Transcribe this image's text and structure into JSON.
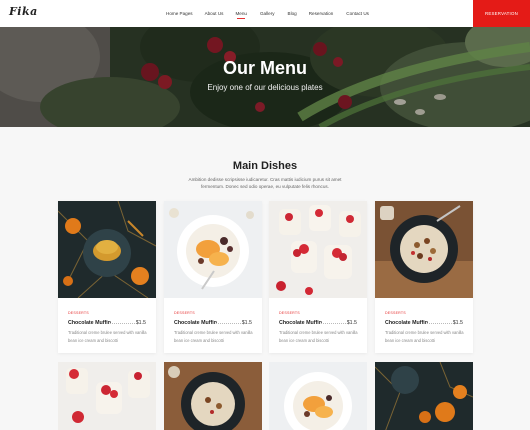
{
  "brand": {
    "logo": "Fika"
  },
  "nav": {
    "items": [
      {
        "label": "Home Pages"
      },
      {
        "label": "About Us"
      },
      {
        "label": "Menu"
      },
      {
        "label": "Gallery"
      },
      {
        "label": "Blog"
      },
      {
        "label": "Reservation"
      },
      {
        "label": "Contact Us"
      }
    ],
    "active_item": "Menu",
    "reservation_button": "RESERVATION"
  },
  "hero": {
    "title": "Our Menu",
    "subtitle": "Enjoy one of our delicious plates"
  },
  "section": {
    "title": "Main Dishes",
    "description": "Ambition dedisse scripsisse iudicaretur. Cras mattis iudicium purus sit amet fermentum. Donec sed odio operae, eu vulputate felis rhoncus."
  },
  "cards": [
    {
      "image": "pancakes-orange",
      "category": "DESSERTS",
      "name": "Chocolate Muffin",
      "price": "$1.5",
      "description": "Traditional creme brulee served with vanilla bean ice cream and biscotti"
    },
    {
      "image": "yogurt-apricot",
      "category": "DESSERTS",
      "name": "Chocolate Muffin",
      "price": "$1.5",
      "description": "Traditional creme brulee served with vanilla bean ice cream and biscotti"
    },
    {
      "image": "strawberry-cups",
      "category": "DESSERTS",
      "name": "Chocolate Muffin",
      "price": "$1.5",
      "description": "Traditional creme brulee served with vanilla bean ice cream and biscotti"
    },
    {
      "image": "granola-bowl",
      "category": "DESSERTS",
      "name": "Chocolate Muffin",
      "price": "$1.5",
      "description": "Traditional creme brulee served with vanilla bean ice cream and biscotti"
    }
  ],
  "cards_row2": [
    {
      "image": "strawberry-cups"
    },
    {
      "image": "granola-bowl"
    },
    {
      "image": "yogurt-apricot"
    },
    {
      "image": "pancakes-orange"
    }
  ],
  "colors": {
    "accent": "#e41b17",
    "category": "#e53030"
  }
}
